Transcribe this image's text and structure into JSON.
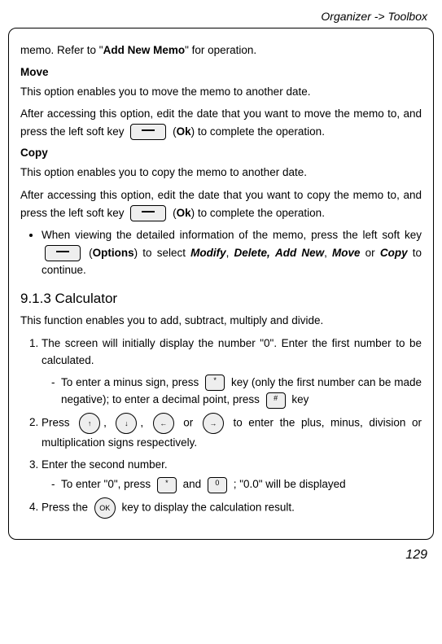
{
  "header": "Organizer -> Toolbox",
  "intro": {
    "pre": "memo. Refer to \"",
    "strong": "Add New Memo",
    "post": "\" for operation."
  },
  "move": {
    "title": "Move",
    "line1": "This option enables you to move the memo to another date.",
    "line2a": "After accessing this option, edit the date that you want to move the memo to, and press the left soft key ",
    "line2b": " (",
    "ok": "Ok",
    "line2c": ") to complete the operation."
  },
  "copy": {
    "title": "Copy",
    "line1": "This option enables you to copy the memo to another date.",
    "line2a": "After accessing this option, edit the date that you want to copy the memo to, and press the left soft key ",
    "line2b": " (",
    "ok": "Ok",
    "line2c": ") to complete the operation."
  },
  "bullet": {
    "pre": "When viewing the detailed information of the memo, press the left soft key ",
    "mid1": " (",
    "options": "Options",
    "mid2": ") to select ",
    "m_modify": "Modify",
    "c1": ", ",
    "m_delete": "Delete,",
    "sp": " ",
    "m_addnew": "Add New",
    "c2": ", ",
    "m_move": "Move",
    "or": " or ",
    "m_copy": "Copy",
    "end": " to continue."
  },
  "section913": "9.1.3 Calculator",
  "calc_intro": "This function enables you to add, subtract, multiply and divide.",
  "step1": "The screen will initially display the number \"0\". Enter the first number to be calculated.",
  "step1sub": {
    "a": "To enter a minus sign, press ",
    "b": " key (only the first number can be made negative); to enter a decimal point, press ",
    "c": " key"
  },
  "step2": {
    "a": "Press ",
    "comma": ", ",
    "or": " or ",
    "b": " to enter the plus, minus, division or multiplication signs respectively."
  },
  "step3": "Enter the second number.",
  "step3sub": {
    "a": "To enter \"0\", press ",
    "and": " and ",
    "b": "; \"0.0\" will be displayed"
  },
  "step4": {
    "a": "Press the ",
    "b": " key to display the calculation result."
  },
  "keys": {
    "star": "*",
    "hash": "#",
    "ok": "OK"
  },
  "pagenum": "129"
}
